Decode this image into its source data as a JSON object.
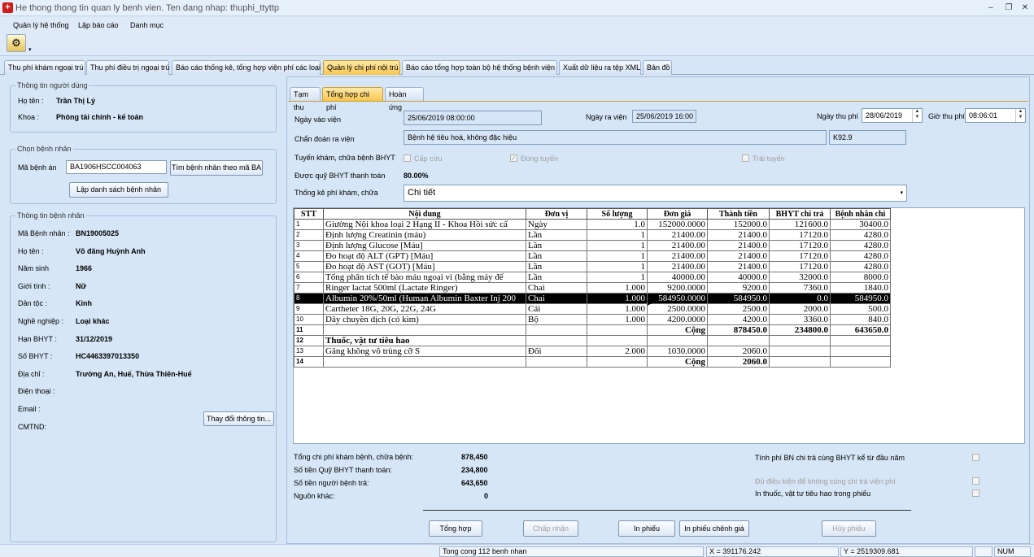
{
  "window": {
    "title": "He thong thong tin quan ly benh vien. Ten dang nhap: thuphi_ttyttp"
  },
  "menu": [
    "Quản lý hệ thống",
    "Lập báo cáo",
    "Danh mục"
  ],
  "tabs": [
    "Thu phí khám ngoại trú",
    "Thu phí điều trị ngoại trú",
    "Báo cáo thống kê, tổng hợp viện phí các loại",
    "Quản lý chi phí nội trú",
    "Báo cáo tổng hợp toàn bộ hệ thống bệnh viện",
    "Xuất dữ liệu ra tệp XML",
    "Bản đồ"
  ],
  "user": {
    "group": "Thông tin người dùng",
    "name_label": "Họ tên :",
    "name": "Trần Thị Lý",
    "dept_label": "Khoa :",
    "dept": "Phòng tài chính - kế toán"
  },
  "choose": {
    "group": "Chọn bệnh nhân",
    "ma_label": "Mã bệnh án",
    "ma_value": "BA1906HSCC004063",
    "find_btn": "Tìm bệnh nhân theo mã BA",
    "list_btn": "Lập danh sách bệnh nhân"
  },
  "patient": {
    "group": "Thông tin bệnh nhân",
    "fields": [
      {
        "label": "Mã Bệnh nhân :",
        "value": "BN19005025"
      },
      {
        "label": "Họ tên :",
        "value": "Võ đăng Huỳnh Anh"
      },
      {
        "label": "Năm sinh",
        "value": "1966"
      },
      {
        "label": "Giới tính :",
        "value": "Nữ"
      },
      {
        "label": "Dân tộc :",
        "value": "Kinh"
      },
      {
        "label": "Nghề nghiệp :",
        "value": "Loại khác"
      },
      {
        "label": "Hạn BHYT :",
        "value": "31/12/2019"
      },
      {
        "label": "Số BHYT :",
        "value": "HC4463397013350"
      },
      {
        "label": "Địa chỉ :",
        "value": "Trường An, Huế, Thừa Thiên-Huế"
      },
      {
        "label": "Điện thoại :",
        "value": ""
      },
      {
        "label": "Email :",
        "value": ""
      },
      {
        "label": "CMTND:",
        "value": ""
      }
    ],
    "change_btn": "Thay đổi thông tin..."
  },
  "subtabs": [
    "Tạm thu",
    "Tổng hợp chi phí",
    "Hoàn ứng"
  ],
  "form": {
    "ngay_vao_label": "Ngày vào viện",
    "ngay_vao": "25/06/2019 08:00:00",
    "ngay_ra_label": "Ngày ra viện",
    "ngay_ra": "25/06/2019 16:00",
    "ngay_thu_label": "Ngày thu phí",
    "ngay_thu": "28/06/2019",
    "gio_thu_label": "Giờ thu phí",
    "gio_thu": "08:06:01",
    "chandoan_label": "Chẩn đoán ra viện",
    "chandoan": "Bệnh hệ tiêu hoá, không đặc hiệu",
    "icd": "K92.9",
    "tuyen_label": "Tuyến khám, chữa bệnh BHYT",
    "capcuu": "Cấp cứu",
    "dungtuyen": "Đúng tuyến",
    "traituyen": "Trái tuyến",
    "quy_label": "Được quỹ BHYT thanh toán",
    "quy_value": "80.00%",
    "thongke_label": "Thống kê phí khám, chữa",
    "thongke_value": "Chi tiết"
  },
  "table": {
    "headers": [
      "STT",
      "Nội dung",
      "Đơn vị",
      "Số lượng",
      "Đơn giá",
      "Thành tiền",
      "BHYT chi trả",
      "Bệnh nhân chi"
    ],
    "rows": [
      {
        "c": [
          "1",
          "Giường Nội khoa loại 2 Hạng II - Khoa Hồi sức cấ",
          "Ngày",
          "1.0",
          "152000.0000",
          "152000.0",
          "121600.0",
          "30400.0"
        ]
      },
      {
        "c": [
          "2",
          "Định lượng Creatinin (máu)",
          "Lần",
          "1",
          "21400.00",
          "21400.0",
          "17120.0",
          "4280.0"
        ]
      },
      {
        "c": [
          "3",
          "Định lượng Glucose [Máu]",
          "Lần",
          "1",
          "21400.00",
          "21400.0",
          "17120.0",
          "4280.0"
        ]
      },
      {
        "c": [
          "4",
          "Đo hoạt độ ALT (GPT) [Máu]",
          "Lần",
          "1",
          "21400.00",
          "21400.0",
          "17120.0",
          "4280.0"
        ]
      },
      {
        "c": [
          "5",
          "Đo hoạt độ AST (GOT) [Máu]",
          "Lần",
          "1",
          "21400.00",
          "21400.0",
          "17120.0",
          "4280.0"
        ]
      },
      {
        "c": [
          "6",
          "Tổng phân tích tế bào máu ngoại vi (bằng máy đế",
          "Lần",
          "1",
          "40000.00",
          "40000.0",
          "32000.0",
          "8000.0"
        ]
      },
      {
        "c": [
          "7",
          "Ringer lactat 500ml (Lactate Ringer)",
          "Chai",
          "1.000",
          "9200.0000",
          "9200.0",
          "7360.0",
          "1840.0"
        ]
      },
      {
        "c": [
          "8",
          "Albumin 20%/50ml (Human Albumin Baxter Inj 200",
          "Chai",
          "1.000",
          "584950.0000",
          "584950.0",
          "0.0",
          "584950.0"
        ],
        "sel": true
      },
      {
        "c": [
          "9",
          "Cartheter 18G, 20G, 22G, 24G",
          "Cái",
          "1.000",
          "2500.0000",
          "2500.0",
          "2000.0",
          "500.0"
        ]
      },
      {
        "c": [
          "10",
          "Dây chuyền dịch (có kim)",
          "Bộ",
          "1.000",
          "4200.0000",
          "4200.0",
          "3360.0",
          "840.0"
        ]
      },
      {
        "c": [
          "11",
          "",
          "",
          "",
          "Cộng",
          "878450.0",
          "234800.0",
          "643650.0"
        ],
        "bold": true
      },
      {
        "c": [
          "12",
          "Thuốc, vật tư tiêu hao",
          "",
          "",
          "",
          "",
          "",
          ""
        ],
        "bold": true
      },
      {
        "c": [
          "13",
          "Găng không vô trùng cỡ S",
          "Đôi",
          "2.000",
          "1030.0000",
          "2060.0",
          "",
          ""
        ]
      },
      {
        "c": [
          "14",
          "",
          "",
          "",
          "Cộng",
          "2060.0",
          "",
          ""
        ],
        "bold": true
      }
    ]
  },
  "summary": {
    "tong_label": "Tổng chi phí khám bệnh, chữa bệnh:",
    "tong": "878,450",
    "quy_label": "Số tiền Quỹ BHYT thanh toán:",
    "quy": "234,800",
    "nb_label": "Số tiền người bệnh trả:",
    "nb": "643,650",
    "khac_label": "Nguồn khác:",
    "khac": "0",
    "opt1": "Tính phí BN chi trả cùng BHYT kể từ đầu năm",
    "opt2": "Đủ điều kiện để không cùng chi trả viện phí",
    "opt3": "In thuốc, vật tư tiêu hao trong phiếu"
  },
  "buttons": {
    "tonghop": "Tổng hợp",
    "chapnhan": "Chấp nhận",
    "inphieu": "In phiếu",
    "inchenhgia": "In phiếu chênh giá",
    "huyphieu": "Hủy phiếu"
  },
  "status": {
    "count": "Tong cong 112 benh nhan",
    "x": "X = 391176.242",
    "y": "Y = 2519309.681",
    "num": "NUM"
  }
}
